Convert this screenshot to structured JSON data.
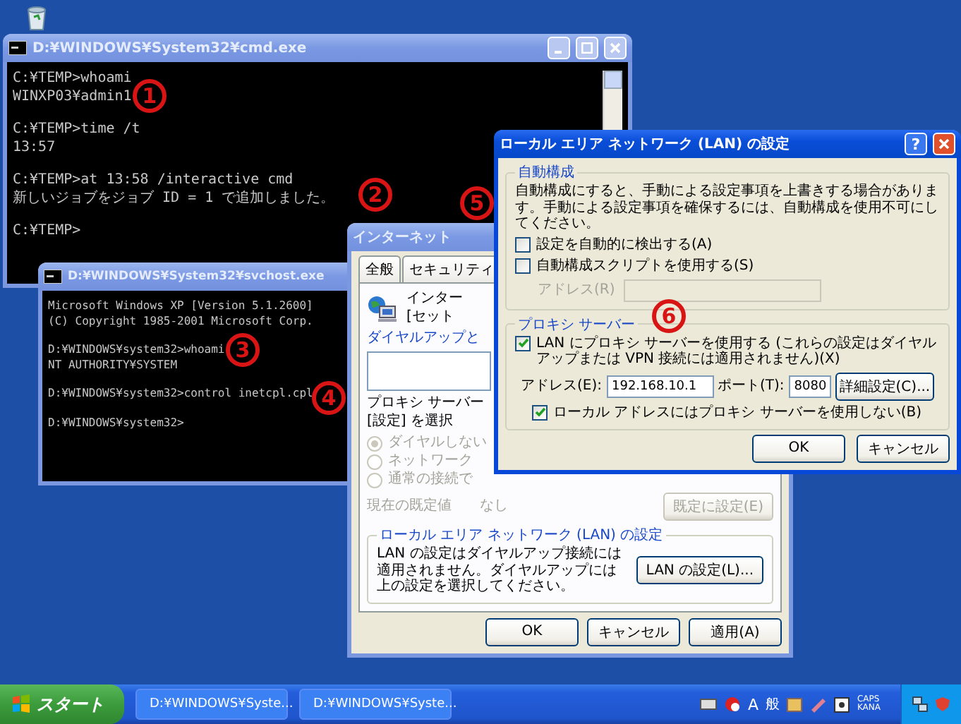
{
  "console_windows": [
    {
      "title": "D:¥WINDOWS¥System32¥cmd.exe",
      "active": false,
      "blocks": [
        [
          "C:¥TEMP>whoami",
          "WINXP03¥admin1"
        ],
        [
          "C:¥TEMP>time /t",
          "13:57"
        ],
        [
          "C:¥TEMP>at 13:58 /interactive cmd",
          "新しいジョブをジョブ ID = 1 で追加しました。"
        ],
        [
          "C:¥TEMP>"
        ]
      ]
    },
    {
      "title": "D:¥WINDOWS¥System32¥svchost.exe",
      "active": false,
      "blocks": [
        [
          "Microsoft Windows XP [Version 5.1.2600]",
          "(C) Copyright 1985-2001 Microsoft Corp."
        ],
        [
          "D:¥WINDOWS¥system32>whoami",
          "NT AUTHORITY¥SYSTEM"
        ],
        [
          "D:¥WINDOWS¥system32>control inetcpl.cpl"
        ],
        [
          "D:¥WINDOWS¥system32>"
        ]
      ]
    }
  ],
  "internet_options": {
    "title": "インターネット",
    "active": false,
    "tabs": [
      {
        "label": "全般",
        "selected": false
      },
      {
        "label": "セキュリティ",
        "selected": false
      }
    ],
    "intro": [
      "インター",
      "[セット"
    ],
    "dialup_group": "ダイヤルアップと",
    "proxy_note": [
      "プロキシ サーバー",
      "[設定] を選択"
    ],
    "radios": [
      {
        "label": "ダイヤルしない",
        "selected": true,
        "disabled": true
      },
      {
        "label": "ネットワーク",
        "selected": false,
        "disabled": true
      },
      {
        "label": "通常の接続で",
        "selected": false,
        "disabled": true
      }
    ],
    "current_default": {
      "label": "現在の既定値",
      "value": "なし",
      "disabled": true
    },
    "set_default_button": {
      "label": "既定に設定(E)",
      "disabled": true
    },
    "lan_group": {
      "title": "ローカル エリア ネットワーク (LAN) の設定",
      "text": "LAN の設定はダイヤルアップ接続には適用されません。ダイヤルアップには上の設定を選択してください。",
      "button": "LAN の設定(L)..."
    },
    "buttons": [
      "OK",
      "キャンセル",
      "適用(A)"
    ]
  },
  "lan_settings": {
    "title": "ローカル エリア ネットワーク (LAN) の設定",
    "active": true,
    "help": "?",
    "auto_config": {
      "title": "自動構成",
      "text": "自動構成にすると、手動による設定事項を上書きする場合があります。手動による設定事項を確保するには、自動構成を使用不可にしてください。",
      "options": [
        {
          "label": "設定を自動的に検出する(A)",
          "checked": false
        },
        {
          "label": "自動構成スクリプトを使用する(S)",
          "checked": false
        }
      ],
      "address": {
        "label": "アドレス(R)",
        "disabled": true
      }
    },
    "proxy": {
      "title": "プロキシ サーバー",
      "use_proxy": {
        "label": "LAN にプロキシ サーバーを使用する (これらの設定はダイヤルアップまたは VPN 接続には適用されません)(X)",
        "checked": true
      },
      "address": {
        "label": "アドレス(E):",
        "value": "192.168.10.1"
      },
      "port": {
        "label": "ポート(T):",
        "value": "8080"
      },
      "advanced_button": "詳細設定(C)...",
      "bypass_local": {
        "label": "ローカル アドレスにはプロキシ サーバーを使用しない(B)",
        "checked": true
      }
    },
    "buttons": [
      "OK",
      "キャンセル"
    ]
  },
  "annotations": [
    {
      "label": "1"
    },
    {
      "label": "2"
    },
    {
      "label": "3"
    },
    {
      "label": "4"
    },
    {
      "label": "5"
    },
    {
      "label": "6"
    }
  ],
  "taskbar": {
    "start": "スタート",
    "tasks": [
      {
        "label": "D:¥WINDOWS¥Syste...",
        "selected": false
      },
      {
        "label": "D:¥WINDOWS¥Syste...",
        "selected": false
      }
    ],
    "tray": {
      "ime_input": "A",
      "ime_mode": "般",
      "caps": "CAPS",
      "kana": "KANA"
    }
  }
}
